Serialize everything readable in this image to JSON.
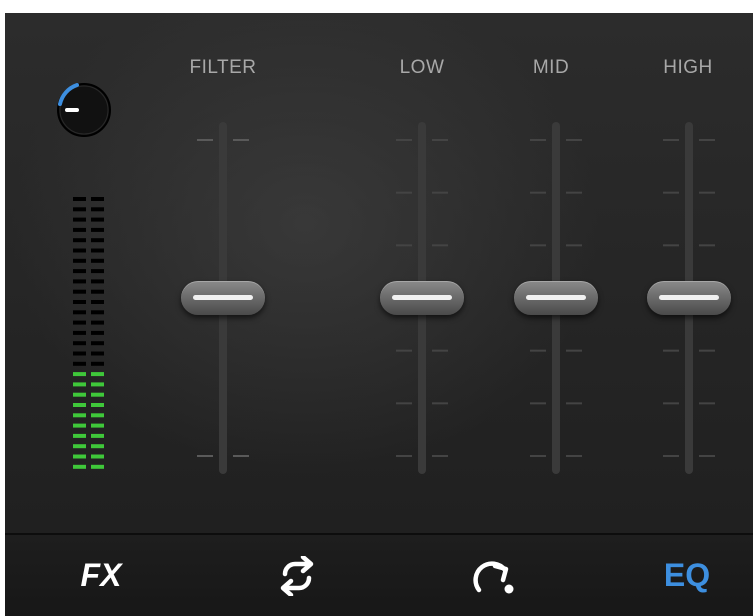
{
  "columns": {
    "filter": {
      "label": "FILTER",
      "value": 0.5
    },
    "low": {
      "label": "LOW",
      "value": 0.5
    },
    "mid": {
      "label": "MID",
      "value": 0.5
    },
    "high": {
      "label": "HIGH",
      "value": 0.5
    }
  },
  "gain_knob": {
    "icon": "gain-knob",
    "accent": "#3d8fe0"
  },
  "level_meter": {
    "lit_fraction": 0.37,
    "lit_color": "#3fc83a",
    "unlit_color": "#000000"
  },
  "tabs": [
    {
      "name": "fx",
      "label": "FX",
      "active": false
    },
    {
      "name": "loop",
      "icon": "loop-icon",
      "active": false
    },
    {
      "name": "cue",
      "icon": "cue-jump-icon",
      "active": false
    },
    {
      "name": "eq",
      "label": "EQ",
      "active": true
    }
  ],
  "colors": {
    "active": "#3d8fe0",
    "inactive": "#ffffff",
    "background": "#262626"
  }
}
